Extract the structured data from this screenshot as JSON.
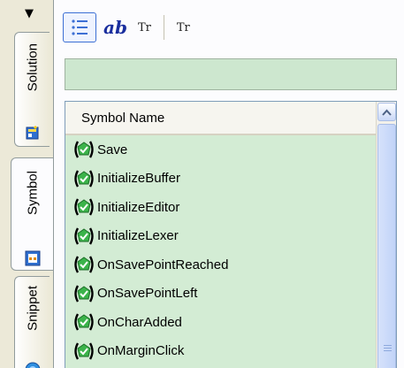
{
  "tabs": [
    {
      "label": "Solution",
      "icon": "solution-icon"
    },
    {
      "label": "Symbol",
      "icon": "symbol-icon",
      "active": true
    },
    {
      "label": "Snippet",
      "icon": "snippet-icon"
    }
  ],
  "toolbar": {
    "list_icon": "list-view-icon",
    "ab_label": "ab",
    "tr1_label": "Tr",
    "tr2_label": "Tr"
  },
  "filter": {
    "value": "",
    "background": "#cde7cf"
  },
  "list": {
    "header": "Symbol Name",
    "icon": "function-icon",
    "items": [
      "Save",
      "InitializeBuffer",
      "InitializeEditor",
      "InitializeLexer",
      "OnSavePointReached",
      "OnSavePointLeft",
      "OnCharAdded",
      "OnMarginClick"
    ],
    "background": "#d3ecd4"
  }
}
